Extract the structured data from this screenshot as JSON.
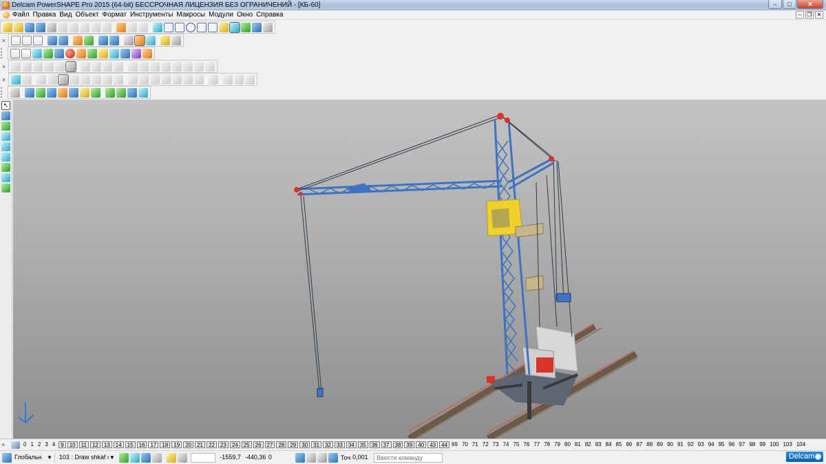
{
  "window": {
    "title": "Delcam PowerSHAPE Pro 2015 (64-bit) БЕССРОЧНАЯ ЛИЦЕНЗИЯ БЕЗ ОГРАНИЧЕНИЙ - [КБ-60]",
    "minimize": "–",
    "maximize": "□",
    "close": "✕"
  },
  "menu": {
    "items": [
      "Файл",
      "Правка",
      "Вид",
      "Объект",
      "Формат",
      "Инструменты",
      "Макросы",
      "Модули",
      "Окно",
      "Справка"
    ],
    "mdi_minimize": "–",
    "mdi_restore": "❐",
    "mdi_close": "✕"
  },
  "toolbars": {
    "close_glyph": "×"
  },
  "viewport": {
    "background_top": "#c3c3c3",
    "background_bottom": "#8e8e8e",
    "crane_color": "#3d73c2",
    "accent_color": "#d9332a",
    "cab_color": "#f0d02a"
  },
  "levels": {
    "close_glyph": "×",
    "items": [
      "0",
      "1",
      "2",
      "3",
      "4",
      "9",
      "10",
      "11",
      "12",
      "13",
      "14",
      "15",
      "16",
      "17",
      "18",
      "19",
      "20",
      "21",
      "22",
      "23",
      "24",
      "25",
      "26",
      "27",
      "28",
      "29",
      "30",
      "31",
      "32",
      "33",
      "34",
      "35",
      "36",
      "37",
      "38",
      "39",
      "40",
      "43",
      "44",
      "69",
      "70",
      "71",
      "72",
      "73",
      "74",
      "75",
      "76",
      "77",
      "78",
      "79",
      "80",
      "81",
      "82",
      "83",
      "84",
      "85",
      "86",
      "87",
      "88",
      "89",
      "90",
      "91",
      "92",
      "93",
      "94",
      "95",
      "96",
      "97",
      "98",
      "99",
      "100",
      "103",
      "104"
    ],
    "boxed": [
      "9",
      "10",
      "11",
      "12",
      "13",
      "14",
      "15",
      "16",
      "17",
      "18",
      "19",
      "20",
      "21",
      "22",
      "23",
      "24",
      "25",
      "26",
      "27",
      "28",
      "29",
      "30",
      "31",
      "32",
      "33",
      "34",
      "35",
      "36",
      "37",
      "38",
      "39",
      "40",
      "43",
      "44"
    ]
  },
  "status": {
    "workplane": "Глобальн",
    "workplane_arrow": "▼",
    "level": "103 : Draw shkaf ι",
    "level_arrow": "▼",
    "coord_x": "-1559,7",
    "coord_y": "-440,36",
    "coord_z": "0",
    "tolerance_label": "Точ",
    "tolerance_value": "0,001",
    "command_placeholder": "Ввести команду",
    "logo": "Delcam"
  }
}
